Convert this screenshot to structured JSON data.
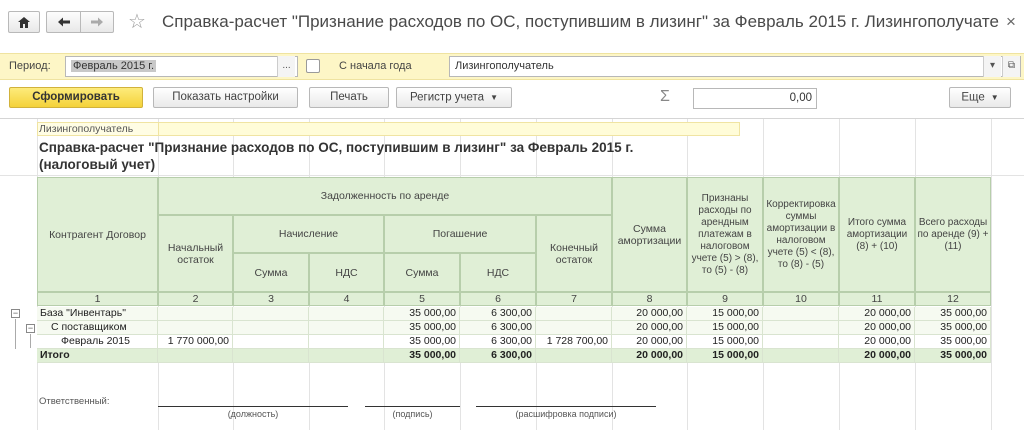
{
  "window": {
    "title": "Справка-расчет \"Признание расходов по ОС, поступившим в лизинг\" за Февраль 2015 г. Лизингополучате",
    "close_symbol": "×",
    "star_symbol": "☆"
  },
  "params": {
    "period_label": "Период:",
    "period_value": "Февраль 2015 г.",
    "period_button": "...",
    "from_year_label": "С начала года",
    "mode_value": "Лизингополучатель",
    "mode_dropdown": "▾",
    "mode_open": "⧉"
  },
  "toolbar": {
    "generate": "Сформировать",
    "show_settings": "Показать настройки",
    "print": "Печать",
    "register": "Регистр учета",
    "sum_sign": "Σ",
    "sum_value": "0,00",
    "more": "Еще"
  },
  "report": {
    "header_label": "Лизингополучатель",
    "title": "Справка-расчет \"Признание расходов по ОС, поступившим в лизинг\" за Февраль 2015 г. (налоговый учет)",
    "columns": {
      "counterparty": "Контрагент Договор",
      "debt": "Задолженность по аренде",
      "opening": "Начальный остаток",
      "accrual": "Начисление",
      "repayment": "Погашение",
      "closing": "Конечный остаток",
      "amount": "Сумма",
      "vat": "НДС",
      "depreciation": "Сумма амортизации",
      "recognized": "Признаны расходы по арендным платежам в налоговом учете (5) > (8), то (5) - (8)",
      "correction": "Корректировка суммы амортизации в налоговом учете (5) < (8), то (8) - (5)",
      "total_depreciation": "Итого сумма амортизации (8) + (10)",
      "total_expenses": "Всего расходы по аренде (9) + (11)"
    },
    "column_numbers": [
      "1",
      "2",
      "3",
      "4",
      "5",
      "6",
      "7",
      "8",
      "9",
      "10",
      "11",
      "12"
    ],
    "rows": [
      {
        "label": "База \"Инвентарь\"",
        "c2": "",
        "c3": "",
        "c4": "",
        "c5": "35 000,00",
        "c6": "6 300,00",
        "c7": "",
        "c8": "20 000,00",
        "c9": "15 000,00",
        "c10": "",
        "c11": "20 000,00",
        "c12": "35 000,00"
      },
      {
        "label": "С поставщиком",
        "c2": "",
        "c3": "",
        "c4": "",
        "c5": "35 000,00",
        "c6": "6 300,00",
        "c7": "",
        "c8": "20 000,00",
        "c9": "15 000,00",
        "c10": "",
        "c11": "20 000,00",
        "c12": "35 000,00"
      },
      {
        "label": "Февраль 2015",
        "c2": "1 770 000,00",
        "c3": "",
        "c4": "",
        "c5": "35 000,00",
        "c6": "6 300,00",
        "c7": "1 728 700,00",
        "c8": "20 000,00",
        "c9": "15 000,00",
        "c10": "",
        "c11": "20 000,00",
        "c12": "35 000,00"
      }
    ],
    "total": {
      "label": "Итого",
      "c2": "",
      "c3": "",
      "c4": "",
      "c5": "35 000,00",
      "c6": "6 300,00",
      "c7": "",
      "c8": "20 000,00",
      "c9": "15 000,00",
      "c10": "",
      "c11": "20 000,00",
      "c12": "35 000,00"
    },
    "tree_symbols": {
      "collapse": "−"
    },
    "signature": {
      "responsible_label": "Ответственный:",
      "position": "(должность)",
      "signature": "(подпись)",
      "transcript": "(расшифровка подписи)"
    }
  }
}
